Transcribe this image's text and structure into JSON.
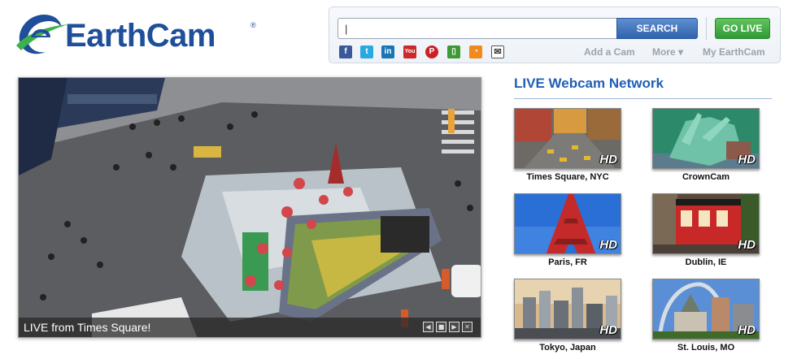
{
  "header": {
    "logo_text": "EarthCam",
    "logo_registered": "®"
  },
  "search": {
    "value": "|",
    "button_label": "SEARCH",
    "golive_label": "GO LIVE"
  },
  "social": [
    {
      "name": "facebook-icon",
      "glyph": "f",
      "color": "#3b5998"
    },
    {
      "name": "twitter-icon",
      "glyph": "t",
      "color": "#2aa9e0"
    },
    {
      "name": "linkedin-icon",
      "glyph": "in",
      "color": "#1b75b5"
    },
    {
      "name": "youtube-icon",
      "glyph": "You",
      "color": "#cc2a2a"
    },
    {
      "name": "pinterest-icon",
      "glyph": "P",
      "color": "#cb2027"
    },
    {
      "name": "mobile-app-icon",
      "glyph": "▯",
      "color": "#3e9a32"
    },
    {
      "name": "rss-icon",
      "glyph": "◔",
      "color": "#f18a1c"
    },
    {
      "name": "email-icon",
      "glyph": "✉",
      "color": "#444444"
    }
  ],
  "nav": {
    "add_cam": "Add a Cam",
    "more": "More ▾",
    "my_earthcam": "My EarthCam"
  },
  "video": {
    "caption": "LIVE from Times Square!",
    "controls": [
      "◀",
      "■",
      "▶",
      "✕"
    ]
  },
  "network": {
    "title": "LIVE Webcam Network",
    "cams": [
      {
        "label": "Times Square, NYC",
        "hd": "HD"
      },
      {
        "label": "CrownCam",
        "hd": "HD"
      },
      {
        "label": "Paris, FR",
        "hd": "HD"
      },
      {
        "label": "Dublin, IE",
        "hd": "HD"
      },
      {
        "label": "Tokyo, Japan",
        "hd": "HD"
      },
      {
        "label": "St. Louis, MO",
        "hd": "HD"
      }
    ]
  }
}
